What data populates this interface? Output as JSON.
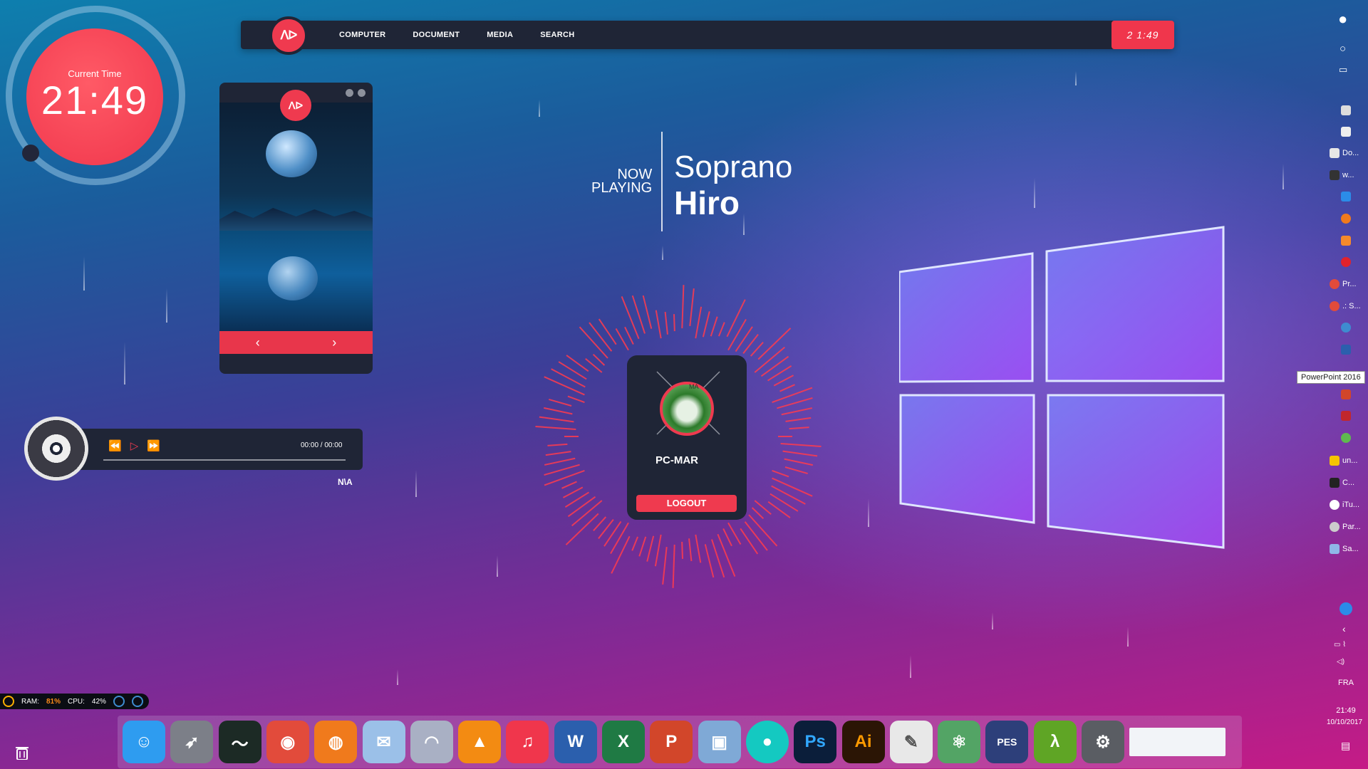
{
  "clock": {
    "label": "Current Time",
    "time": "21:49"
  },
  "topbar": {
    "logo": "ᐱᐅ",
    "nav": [
      "COMPUTER",
      "DOCUMENT",
      "MEDIA",
      "SEARCH"
    ],
    "time": "2 1:49"
  },
  "image_card": {
    "logo": "ᐱᐅ",
    "prev": "‹",
    "next": "›"
  },
  "player": {
    "time": "00:00 / 00:00",
    "track": "N\\A",
    "prev": "⏪",
    "play": "▷",
    "next": "⏩"
  },
  "now_playing": {
    "line1": "NOW",
    "line2": "PLAYING",
    "artist": "Soprano",
    "title": "Hiro"
  },
  "login": {
    "avatar_text": "MA",
    "user": "PC-MAR",
    "logout": "LOGOUT"
  },
  "right_taskbar": {
    "items": [
      "Do...",
      "w...",
      "Pr...",
      ".: S...",
      "un...",
      "C...",
      "iTu...",
      "Par...",
      "Sa..."
    ],
    "tooltip": "PowerPoint 2016",
    "lang": "FRA",
    "time": "21:49",
    "date": "10/10/2017"
  },
  "stats": {
    "ram_label": "RAM:",
    "ram": "81%",
    "cpu_label": "CPU:",
    "cpu": "42%"
  },
  "dock": {
    "apps": [
      {
        "name": "finder",
        "glyph": "☺",
        "color": "#2e9cf0"
      },
      {
        "name": "launchpad",
        "glyph": "➶",
        "color": "#7c7f88"
      },
      {
        "name": "activity-monitor",
        "glyph": "〜",
        "color": "#1c2a25"
      },
      {
        "name": "chrome",
        "glyph": "◉",
        "color": "#e24b3b"
      },
      {
        "name": "firefox",
        "glyph": "◍",
        "color": "#f07a1c"
      },
      {
        "name": "mail",
        "glyph": "✉",
        "color": "#9bc0e8"
      },
      {
        "name": "bittorrent",
        "glyph": "◠",
        "color": "#a9b0c4"
      },
      {
        "name": "vlc",
        "glyph": "▲",
        "color": "#f38b12"
      },
      {
        "name": "itunes",
        "glyph": "♫",
        "color": "#f0364c"
      },
      {
        "name": "word",
        "glyph": "W",
        "color": "#2b5fad"
      },
      {
        "name": "excel",
        "glyph": "X",
        "color": "#1f7a44"
      },
      {
        "name": "powerpoint",
        "glyph": "P",
        "color": "#d2462a"
      },
      {
        "name": "preview",
        "glyph": "▣",
        "color": "#7fa9d6"
      },
      {
        "name": "teal-app",
        "glyph": "●",
        "color": "#14c9c1"
      },
      {
        "name": "photoshop",
        "glyph": "Ps",
        "color": "#0b1e3a"
      },
      {
        "name": "illustrator",
        "glyph": "Ai",
        "color": "#2b1505"
      },
      {
        "name": "textedit",
        "glyph": "✎",
        "color": "#e8e8e8"
      },
      {
        "name": "atom",
        "glyph": "⚛",
        "color": "#53a465"
      },
      {
        "name": "pes",
        "glyph": "PES",
        "color": "#2d3f7a"
      },
      {
        "name": "lambda",
        "glyph": "λ",
        "color": "#5fa525"
      },
      {
        "name": "system-preferences",
        "glyph": "⚙",
        "color": "#5a5d63"
      },
      {
        "name": "window-thumb",
        "glyph": "",
        "color": "#f2f4f8"
      }
    ]
  }
}
